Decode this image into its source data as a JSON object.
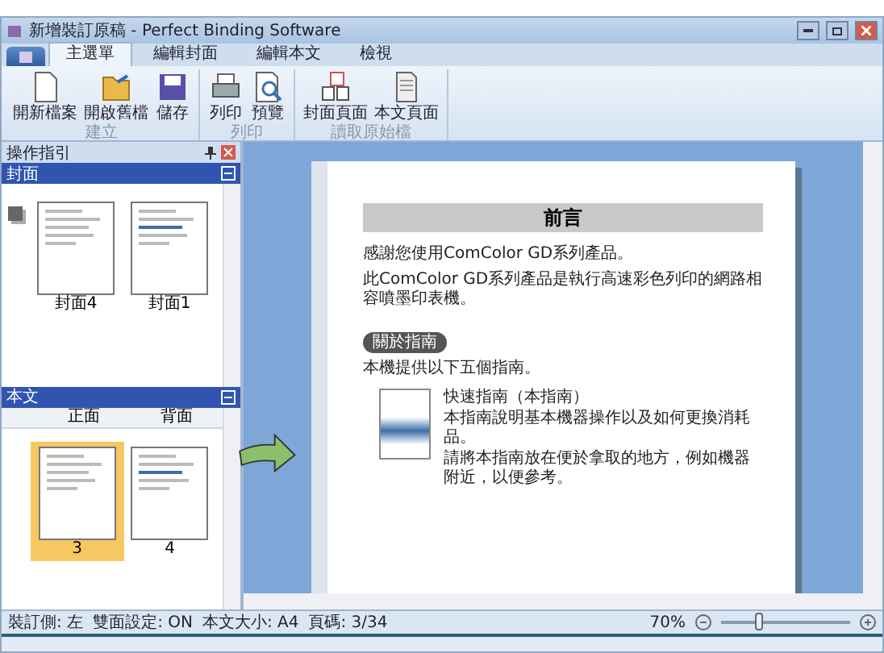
{
  "window": {
    "title": "新增裝訂原稿 - Perfect Binding Software"
  },
  "ribbon": {
    "tabs": [
      {
        "label": "主選單",
        "selected": true
      },
      {
        "label": "編輯封面",
        "selected": false
      },
      {
        "label": "編輯本文",
        "selected": false
      },
      {
        "label": "檢視",
        "selected": false
      }
    ],
    "groups": [
      {
        "label": "建立",
        "buttons": [
          {
            "kind": "new",
            "label": "開新檔案"
          },
          {
            "kind": "open",
            "label": "開啟舊檔"
          },
          {
            "kind": "save",
            "label": "儲存"
          }
        ]
      },
      {
        "label": "列印",
        "buttons": [
          {
            "kind": "print",
            "label": "列印"
          },
          {
            "kind": "preview",
            "label": "預覽"
          }
        ]
      },
      {
        "label": "讀取原始檔",
        "buttons": [
          {
            "kind": "cover",
            "label": "封面頁面"
          },
          {
            "kind": "body",
            "label": "本文頁面"
          }
        ]
      }
    ]
  },
  "navigator": {
    "title": "操作指引",
    "sections": [
      {
        "title": "封面",
        "pages": [
          {
            "label": "封面4",
            "selected": false
          },
          {
            "label": "封面1",
            "selected": false
          }
        ]
      },
      {
        "title": "本文",
        "columns": [
          "正面",
          "背面"
        ],
        "pages": [
          {
            "label": "3",
            "selected": true
          },
          {
            "label": "4",
            "selected": false
          }
        ]
      }
    ]
  },
  "document": {
    "heading": "前言",
    "intro": [
      "感謝您使用ComColor GD系列產品。",
      "此ComColor GD系列產品是執行高速彩色列印的網路相容噴墨印表機。"
    ],
    "badge": "關於指南",
    "lead": "本機提供以下五個指南。",
    "guides": [
      {
        "title": "快速指南（本指南）",
        "lines": [
          "本指南說明基本機器操作以及如何更換消耗品。",
          "請將本指南放在便於拿取的地方，例如機器附近，以便參考。"
        ]
      }
    ]
  },
  "status_bar": {
    "items": [
      "裝訂側: 左",
      "雙面設定: ON",
      "本文大小: A4",
      "頁碼: 3/34"
    ],
    "zoom": {
      "reading": "70%",
      "level": 0.3
    }
  }
}
